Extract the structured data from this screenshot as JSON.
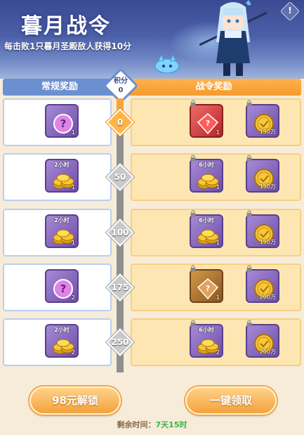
{
  "banner": {
    "title": "暮月战令",
    "subtitle": "每击败1只暮月圣殿敌人获得10分",
    "help_glyph": "!"
  },
  "headers": {
    "normal": "常规奖励",
    "pass": "战令奖励",
    "score_label": "积分",
    "score_value": "0"
  },
  "tiers": [
    {
      "milestone": "0",
      "active": true,
      "normal": {
        "icon": "mystery-box-icon",
        "color": "purple",
        "count": "1",
        "time": ""
      },
      "pass": [
        {
          "icon": "red-box-icon",
          "color": "red",
          "count": "1",
          "time": ""
        },
        {
          "icon": "gold-coin-icon",
          "color": "purple",
          "count": "150万",
          "time": ""
        }
      ]
    },
    {
      "milestone": "50",
      "active": false,
      "normal": {
        "icon": "coin-stack-icon",
        "color": "purple",
        "count": "1",
        "time": "2小时"
      },
      "pass": [
        {
          "icon": "coin-stack-icon",
          "color": "purple",
          "count": "1",
          "time": "6小时"
        },
        {
          "icon": "gold-coin-icon",
          "color": "purple",
          "count": "150万",
          "time": ""
        }
      ]
    },
    {
      "milestone": "100",
      "active": false,
      "normal": {
        "icon": "coin-stack-icon",
        "color": "purple",
        "count": "1",
        "time": "2小时"
      },
      "pass": [
        {
          "icon": "coin-stack-icon",
          "color": "purple",
          "count": "1",
          "time": "6小时"
        },
        {
          "icon": "gold-coin-icon",
          "color": "purple",
          "count": "150万",
          "time": ""
        }
      ]
    },
    {
      "milestone": "175",
      "active": false,
      "normal": {
        "icon": "mystery-box-icon",
        "color": "purple",
        "count": "2",
        "time": ""
      },
      "pass": [
        {
          "icon": "brown-box-icon",
          "color": "brown",
          "count": "1",
          "time": ""
        },
        {
          "icon": "gold-coin-icon",
          "color": "purple",
          "count": "200万",
          "time": ""
        }
      ]
    },
    {
      "milestone": "250",
      "active": false,
      "normal": {
        "icon": "coin-stack-icon",
        "color": "purple",
        "count": "2",
        "time": "2小时"
      },
      "pass": [
        {
          "icon": "coin-stack-icon",
          "color": "purple",
          "count": "2",
          "time": "6小时"
        },
        {
          "icon": "gold-coin-icon",
          "color": "purple",
          "count": "200万",
          "time": ""
        }
      ]
    }
  ],
  "footer": {
    "unlock_button": "98元解锁",
    "claim_all_button": "一键领取",
    "remaining_label": "剩余时间：",
    "remaining_value": "7天15时"
  },
  "colors": {
    "normal_header": "#6c8fd0",
    "pass_header": "#f59a2e",
    "active_milestone": "#ffb445",
    "remaining_time": "#3cb34a"
  }
}
